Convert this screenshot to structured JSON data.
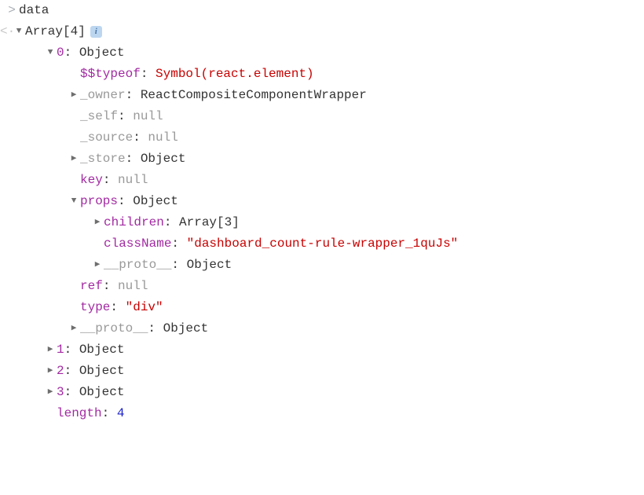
{
  "line0": {
    "prompt": ">",
    "text": "data"
  },
  "line1": {
    "prompt": "<·",
    "label": "Array[4]"
  },
  "root": {
    "index0": {
      "key": "0",
      "value": "Object",
      "typeof_key": "$$typeof",
      "typeof_val": "Symbol(react.element)",
      "owner_key": "_owner",
      "owner_val": "ReactCompositeComponentWrapper",
      "self_key": "_self",
      "self_val": "null",
      "source_key": "_source",
      "source_val": "null",
      "store_key": "_store",
      "store_val": "Object",
      "key_key": "key",
      "key_val": "null",
      "props_key": "props",
      "props_val": "Object",
      "props": {
        "children_key": "children",
        "children_val": "Array[3]",
        "className_key": "className",
        "className_val": "\"dashboard_count-rule-wrapper_1quJs\"",
        "proto_key": "__proto__",
        "proto_val": "Object"
      },
      "ref_key": "ref",
      "ref_val": "null",
      "type_key": "type",
      "type_val": "\"div\"",
      "proto_key": "__proto__",
      "proto_val": "Object"
    },
    "index1": {
      "key": "1",
      "value": "Object"
    },
    "index2": {
      "key": "2",
      "value": "Object"
    },
    "index3": {
      "key": "3",
      "value": "Object"
    },
    "length_key": "length",
    "length_val": "4"
  },
  "sep": ": "
}
